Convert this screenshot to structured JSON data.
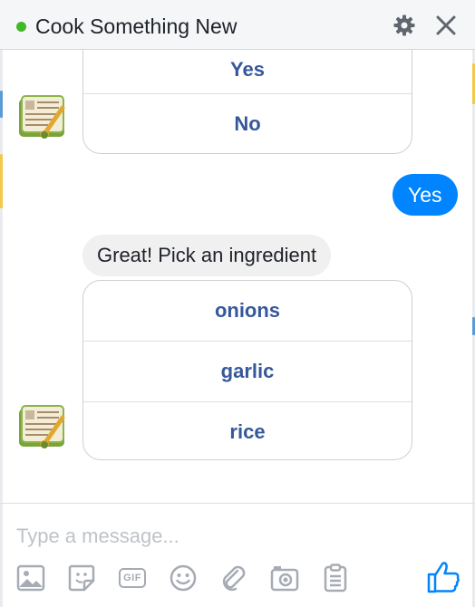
{
  "header": {
    "title": "Cook Something New",
    "status": "online",
    "status_color": "#42b72a",
    "settings_icon": "gear-icon",
    "close_icon": "close-icon"
  },
  "messages": {
    "top_card": {
      "buttons": [
        "Yes",
        "No"
      ]
    },
    "user_reply": "Yes",
    "bot_text": "Great! Pick an ingredient",
    "ingredient_card": {
      "buttons": [
        "onions",
        "garlic",
        "rice"
      ]
    },
    "bot_avatar_icon": "recipe-book-icon"
  },
  "composer": {
    "placeholder": "Type a message...",
    "tools": [
      "photo-icon",
      "sticker-icon",
      "gif-icon",
      "emoji-icon",
      "attachment-icon",
      "camera-icon",
      "clipboard-icon"
    ],
    "gif_label": "GIF",
    "send_icon": "thumbs-up-icon"
  },
  "colors": {
    "accent": "#0084ff",
    "link_blue": "#365899",
    "bot_bubble": "#f1f0f0"
  }
}
